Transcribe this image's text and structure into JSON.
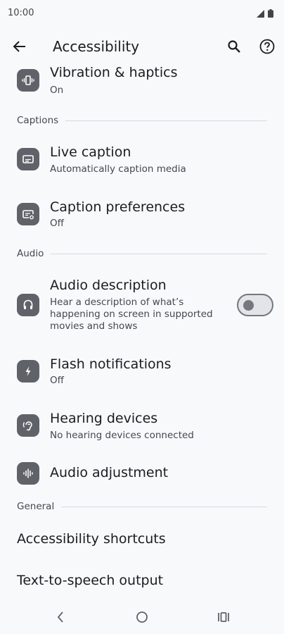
{
  "status_bar": {
    "time": "10:00"
  },
  "app_bar": {
    "title": "Accessibility"
  },
  "items": {
    "vibration": {
      "title": "Vibration & haptics",
      "subtitle": "On"
    },
    "live_caption": {
      "title": "Live caption",
      "subtitle": "Automatically caption media"
    },
    "caption_prefs": {
      "title": "Caption preferences",
      "subtitle": "Off"
    },
    "audio_description": {
      "title": "Audio description",
      "subtitle": "Hear a description of what’s happening on screen in supported movies and shows",
      "enabled": false
    },
    "flash": {
      "title": "Flash notifications",
      "subtitle": "Off"
    },
    "hearing": {
      "title": "Hearing devices",
      "subtitle": "No hearing devices connected"
    },
    "audio_adjustment": {
      "title": "Audio adjustment"
    },
    "shortcuts": {
      "title": "Accessibility shortcuts"
    },
    "tts": {
      "title": "Text-to-speech output"
    }
  },
  "sections": {
    "captions": "Captions",
    "audio": "Audio",
    "general": "General"
  },
  "colors": {
    "icon_bg": "#5f6369",
    "background": "#f8f9fb",
    "text": "#1b1c1f"
  }
}
